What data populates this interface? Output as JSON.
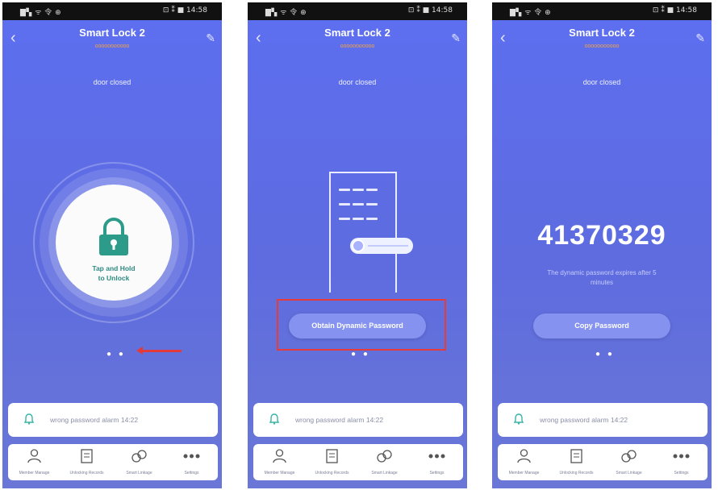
{
  "status_left": "▇▚ ᯤ 令 ⊕",
  "status_right": "⊡ ⁑ ■ 14:58",
  "screens": [
    {
      "title": "Smart Lock 2",
      "subtitle": "ooooooooooo",
      "door_status": "door closed",
      "lock_text_1": "Tap and Hold",
      "lock_text_2": "to Unlock",
      "page_dots": "● ●",
      "alarm_text": "wrong password alarm 14:22",
      "nav": [
        "Member Manage",
        "Unlocking Records",
        "Smart Linkage",
        "Settings"
      ]
    },
    {
      "title": "Smart Lock 2",
      "subtitle": "ooooooooooo",
      "door_status": "door closed",
      "obtain_button": "Obtain Dynamic Password",
      "page_dots": "● ●",
      "alarm_text": "wrong password alarm 14:22",
      "nav": [
        "Member Manage",
        "Unlocking Records",
        "Smart Linkage",
        "Settings"
      ]
    },
    {
      "title": "Smart Lock 2",
      "subtitle": "ooooooooooo",
      "door_status": "door closed",
      "dynamic_code": "41370329",
      "code_note_1": "The dynamic password expires after 5",
      "code_note_2": "minutes",
      "copy_button": "Copy Password",
      "page_dots": "● ●",
      "alarm_text": "wrong password alarm 14:22",
      "nav": [
        "Member Manage",
        "Unlocking Records",
        "Smart Linkage",
        "Settings"
      ]
    }
  ],
  "colors": {
    "background": "#5e6cdf",
    "lock_green": "#2d9b8a",
    "highlight_red": "#e53b3b",
    "subtitle_orange": "#f3a340"
  }
}
